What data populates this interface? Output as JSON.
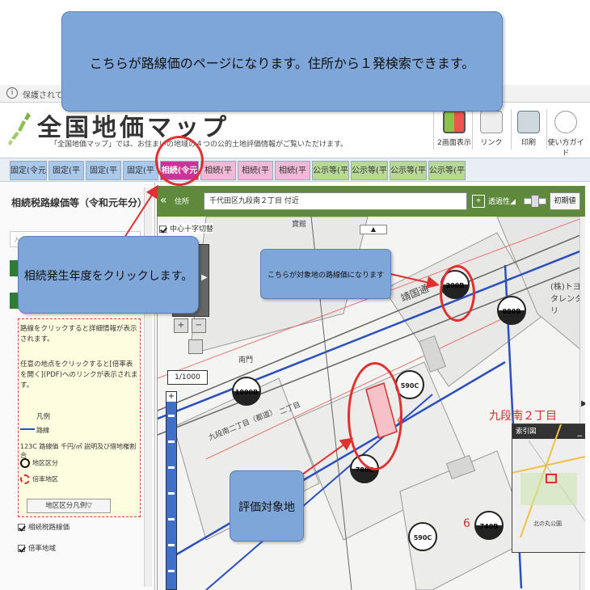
{
  "browser": {
    "security_text": "保護されていな",
    "info_icon": "i"
  },
  "header": {
    "title": "全国地価マップ",
    "subtitle": "「全国地価マップ」では、お住まいの地域の４つの公的土地評価情報がご覧いただけます。",
    "buttons": [
      {
        "label": "2画面表示",
        "icon": "dual-screen-icon"
      },
      {
        "label": "リンク",
        "icon": "link-icon"
      },
      {
        "label": "印刷",
        "icon": "printer-icon"
      },
      {
        "label": "使い方ガイド",
        "icon": "guide-icon"
      }
    ]
  },
  "tabs": [
    {
      "label": "固定(令元年)",
      "kind": "blue"
    },
    {
      "label": "固定(平30)",
      "kind": "blue"
    },
    {
      "label": "固定(平29)",
      "kind": "blue"
    },
    {
      "label": "固定(平28",
      "kind": "blue"
    },
    {
      "label": "相続(令元年)",
      "kind": "active"
    },
    {
      "label": "相続(平30)",
      "kind": "pink"
    },
    {
      "label": "相続(平29)",
      "kind": "pink"
    },
    {
      "label": "相続(平28)",
      "kind": "pink"
    },
    {
      "label": "公示等(平31)",
      "kind": "green"
    },
    {
      "label": "公示等(平30)",
      "kind": "green"
    },
    {
      "label": "公示等(平29)",
      "kind": "green"
    },
    {
      "label": "公示等(平28)",
      "kind": "green"
    }
  ],
  "left_panel": {
    "title": "相続税路線価等（令和元年分）",
    "input_placeholder": "入力",
    "help_text_1": "路線をクリックすると詳細情報が表示されます。",
    "help_text_2": "任意の地点をクリックすると[倍率表を開く](PDF)へのリンクが表示されます。",
    "legend_title": "凡例",
    "legend_route": "路線",
    "legend_price": "123C 路線価 千円/㎡ 説明及び借地権割合",
    "legend_district": "地区区分",
    "legend_ratio": "倍率地区",
    "legend_button": "地区区分凡例▽",
    "check_route_price": "相続税路線価",
    "check_ratio_area": "倍率地域"
  },
  "map_toolbar": {
    "collapse": "«",
    "address_label": "住所",
    "address_value": "千代田区九段南２丁目 付近",
    "target_icon": "⌖",
    "transparency_label": "透過性◢",
    "reset_button": "初期値"
  },
  "map": {
    "center_cross_label": "中心十字切替",
    "scroll_up": "▲",
    "scale": "1/1000",
    "zoom_in": "+",
    "zoom_plus_icon": "+",
    "zoom_minus_icon": "−",
    "right_arrow": "▶",
    "left_arrow": "▶",
    "index_map_title": "索引図",
    "index_map_minimize": "_",
    "index_map_caption": "北の丸公園",
    "district_label": "九段南２丁目",
    "road_label": "靖国通",
    "building_label": "(株)トヨタレンタリ",
    "plot_number": "4",
    "plot_number_2": "6",
    "ward_office_label": "寶館",
    "gate_label": "南門",
    "route_label_1": "九段南二丁目（都道）",
    "route_label_2": "二丁目",
    "prices": [
      "200B",
      "880B",
      "1800B",
      "590C",
      "780C",
      "590C",
      "740B"
    ]
  },
  "callouts": {
    "top": "こちらが路線価のページになります。住所から１発検索できます。",
    "left": "相続発生年度をクリックします。",
    "mid": "こちらが対象地の路線価になります",
    "bottom": "評価対象地"
  },
  "colors": {
    "active_tab": "#cc3399",
    "toolbar_green": "#5f8a3c",
    "callout_blue": "#7fa6d8",
    "annotation_red": "#e03030"
  }
}
